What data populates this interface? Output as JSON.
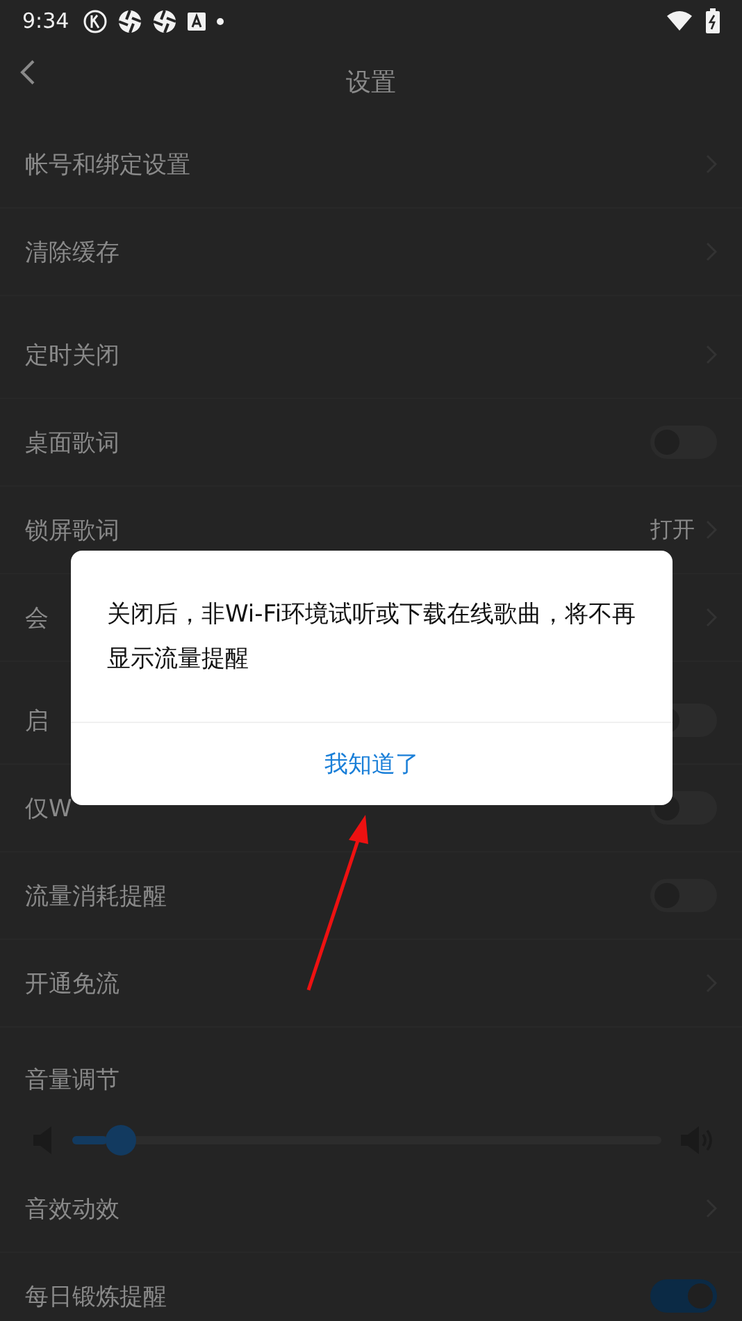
{
  "status_bar": {
    "time": "9:34"
  },
  "header": {
    "title": "设置"
  },
  "sections": [
    {
      "rows": [
        {
          "kind": "link",
          "label": "帐号和绑定设置"
        },
        {
          "kind": "link",
          "label": "清除缓存"
        }
      ]
    },
    {
      "rows": [
        {
          "kind": "link",
          "label": "定时关闭"
        },
        {
          "kind": "toggle",
          "label": "桌面歌词",
          "on": false
        },
        {
          "kind": "link",
          "label": "锁屏歌词",
          "value": "打开"
        },
        {
          "kind": "link",
          "label": "会"
        }
      ]
    },
    {
      "rows": [
        {
          "kind": "toggle",
          "label": "启",
          "on": false
        },
        {
          "kind": "toggle",
          "label": "仅W",
          "on": false
        },
        {
          "kind": "toggle",
          "label": "流量消耗提醒",
          "on": false
        },
        {
          "kind": "link",
          "label": "开通免流"
        }
      ]
    },
    {
      "rows": [
        {
          "kind": "volume",
          "label": "音量调节",
          "level": 0.06
        },
        {
          "kind": "link",
          "label": "音效动效"
        },
        {
          "kind": "toggle",
          "label": "每日锻炼提醒",
          "on": true
        }
      ]
    }
  ],
  "dialog": {
    "message": "关闭后，非Wi-Fi环境试听或下载在线歌曲，将不再显示流量提醒",
    "button": "我知道了"
  }
}
